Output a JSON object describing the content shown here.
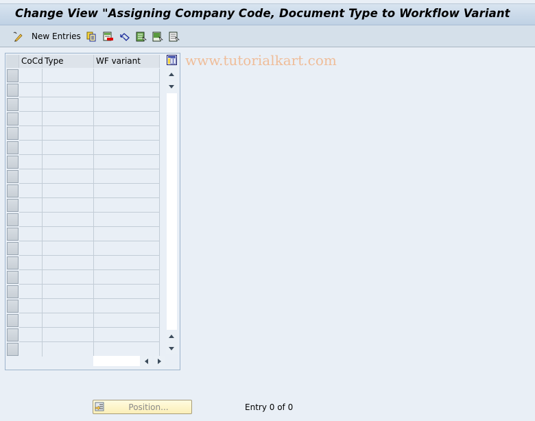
{
  "window": {
    "title": "Change View \"Assigning Company Code, Document Type to Workflow Variant"
  },
  "toolbar": {
    "items": [
      {
        "icon": "display-change-icon",
        "label": ""
      },
      {
        "icon": "new-entries-label",
        "label": "New Entries"
      },
      {
        "icon": "copy-icon",
        "label": ""
      },
      {
        "icon": "delete-icon",
        "label": ""
      },
      {
        "icon": "undo-icon",
        "label": ""
      },
      {
        "icon": "select-all-icon",
        "label": ""
      },
      {
        "icon": "select-block-icon",
        "label": ""
      },
      {
        "icon": "deselect-all-icon",
        "label": ""
      }
    ],
    "new_entries_label": "New Entries",
    "watermark": "www.tutorialkart.com"
  },
  "table": {
    "columns": [
      "CoCd",
      "Type",
      "WF variant"
    ],
    "row_count": 20,
    "rows": []
  },
  "footer": {
    "position_button_label": "Position...",
    "entry_status": "Entry 0 of 0"
  },
  "colors": {
    "title_gradient_top": "#d8e4f0",
    "title_gradient_bottom": "#bfd1e4",
    "background": "#e9eff6",
    "toolbar_bg": "#d5e0ea",
    "position_button_bg": "#fbefb8",
    "watermark": "#f0b890"
  }
}
